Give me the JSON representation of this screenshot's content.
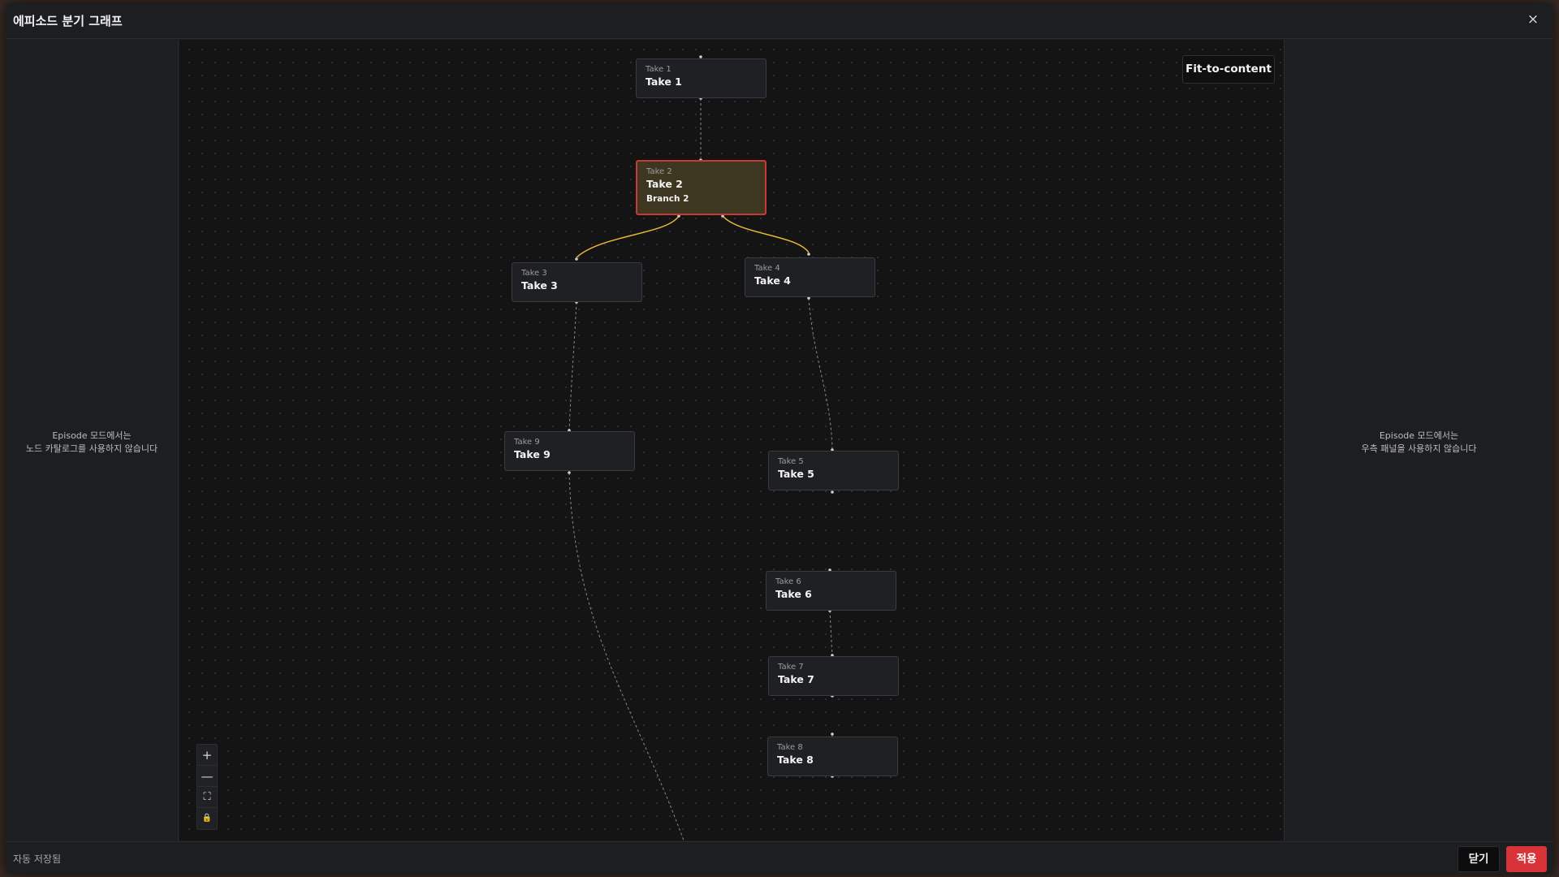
{
  "window": {
    "title": "에피소드 분기 그래프",
    "close_icon": "×"
  },
  "left_panel": {
    "message_line1": "Episode 모드에서는",
    "message_line2": "노드 카탈로그를 사용하지 않습니다"
  },
  "right_panel": {
    "message_line1": "Episode 모드에서는",
    "message_line2": "우측 패널을 사용하지 않습니다"
  },
  "canvas": {
    "fit_button": "Fit-to-content",
    "nodes": [
      {
        "id": "take1",
        "sub": "Take 1",
        "title": "Take 1"
      },
      {
        "id": "take2",
        "sub": "Take 2",
        "title": "Take 2",
        "branch": "Branch 2",
        "selected": true
      },
      {
        "id": "take3",
        "sub": "Take 3",
        "title": "Take 3"
      },
      {
        "id": "take4",
        "sub": "Take 4",
        "title": "Take 4"
      },
      {
        "id": "take9",
        "sub": "Take 9",
        "title": "Take 9"
      },
      {
        "id": "take5",
        "sub": "Take 5",
        "title": "Take 5"
      },
      {
        "id": "take6",
        "sub": "Take 6",
        "title": "Take 6"
      },
      {
        "id": "take7",
        "sub": "Take 7",
        "title": "Take 7"
      },
      {
        "id": "take8",
        "sub": "Take 8",
        "title": "Take 8"
      }
    ],
    "edges": [
      {
        "from": "take1",
        "to": "take2",
        "kind": "dashed"
      },
      {
        "from": "take2",
        "to": "take3",
        "kind": "branch"
      },
      {
        "from": "take2",
        "to": "take4",
        "kind": "branch"
      },
      {
        "from": "take3",
        "to": "take9",
        "kind": "dashed"
      },
      {
        "from": "take4",
        "to": "take5",
        "kind": "dashed"
      },
      {
        "from": "take6",
        "to": "take7",
        "kind": "dashed"
      }
    ],
    "colors": {
      "branch_edge": "#e8b73a",
      "dashed_edge": "#8a8a8a",
      "selected_border": "#c83a38",
      "selected_fill": "#3d3620"
    },
    "controls": {
      "zoom_in": "+",
      "zoom_out": "—",
      "fit_view": "⛶",
      "lock": "🔒"
    }
  },
  "footer": {
    "status": "자동 저장됨",
    "close_label": "닫기",
    "apply_label": "적용"
  }
}
